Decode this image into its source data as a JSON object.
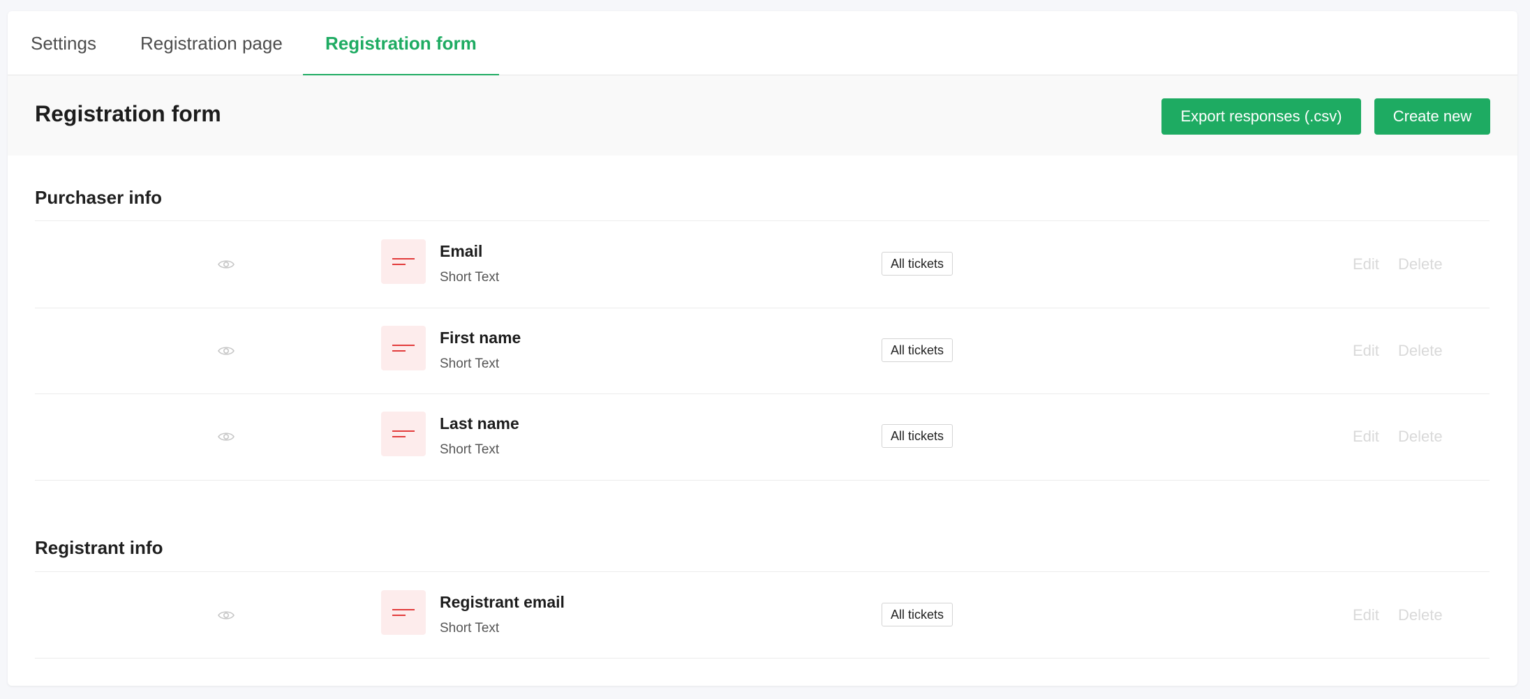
{
  "tabs": [
    {
      "label": "Settings"
    },
    {
      "label": "Registration page"
    },
    {
      "label": "Registration form",
      "active": true
    }
  ],
  "header": {
    "title": "Registration form",
    "export_label": "Export responses (.csv)",
    "create_label": "Create new"
  },
  "sections": [
    {
      "title": "Purchaser info",
      "fields": [
        {
          "name": "Email",
          "type": "Short Text",
          "badge": "All tickets",
          "edit": "Edit",
          "delete": "Delete"
        },
        {
          "name": "First name",
          "type": "Short Text",
          "badge": "All tickets",
          "edit": "Edit",
          "delete": "Delete"
        },
        {
          "name": "Last name",
          "type": "Short Text",
          "badge": "All tickets",
          "edit": "Edit",
          "delete": "Delete"
        }
      ]
    },
    {
      "title": "Registrant info",
      "fields": [
        {
          "name": "Registrant email",
          "type": "Short Text",
          "badge": "All tickets",
          "edit": "Edit",
          "delete": "Delete"
        }
      ]
    }
  ],
  "icons": {
    "visibility": "eye-icon",
    "field_type": "short-text-icon"
  },
  "colors": {
    "accent": "#1eab62",
    "field_icon_bg": "#fdecec",
    "field_icon_fg": "#e23b3b",
    "disabled_action": "#d9d9d9"
  }
}
